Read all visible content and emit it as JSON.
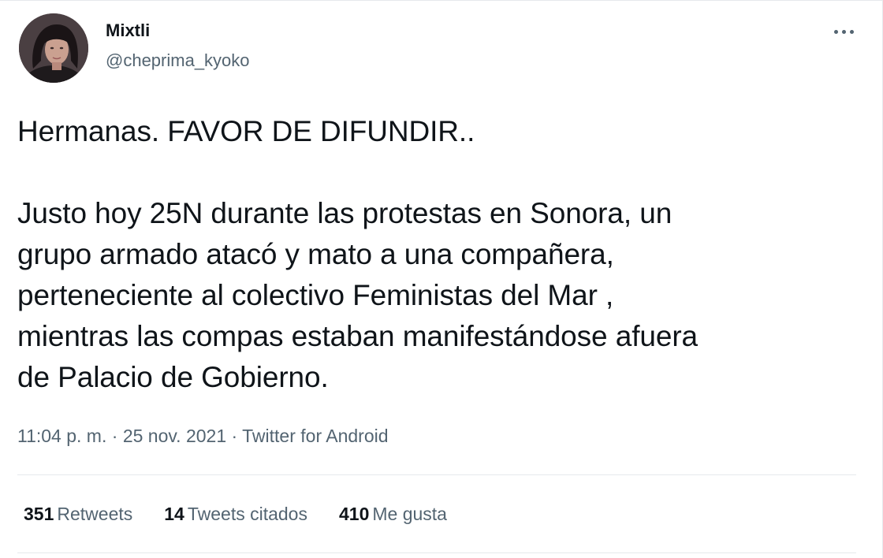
{
  "tweet": {
    "author": {
      "name": "Mixtli",
      "handle": "@cheprima_kyoko",
      "avatar_icon": "user-avatar-photo"
    },
    "more_icon": "more-horizontal-icon",
    "text": "Hermanas. FAVOR DE DIFUNDIR..\n\nJusto hoy 25N  durante las protestas en Sonora, un\ngrupo armado atacó y mato a una compañera,\nperteneciente al colectivo Feministas del Mar ,\nmientras las compas  estaban manifestándose afuera\nde Palacio de Gobierno.",
    "time": "11:04 p. m.",
    "separator": "·",
    "date": "25 nov. 2021",
    "source": "Twitter for Android",
    "stats": {
      "retweets_count": "351",
      "retweets_label": "Retweets",
      "quotes_count": "14",
      "quotes_label": "Tweets citados",
      "likes_count": "410",
      "likes_label": "Me gusta"
    }
  },
  "colors": {
    "text_primary": "#0f1419",
    "text_secondary": "#536471",
    "divider": "#e6e9ec"
  }
}
